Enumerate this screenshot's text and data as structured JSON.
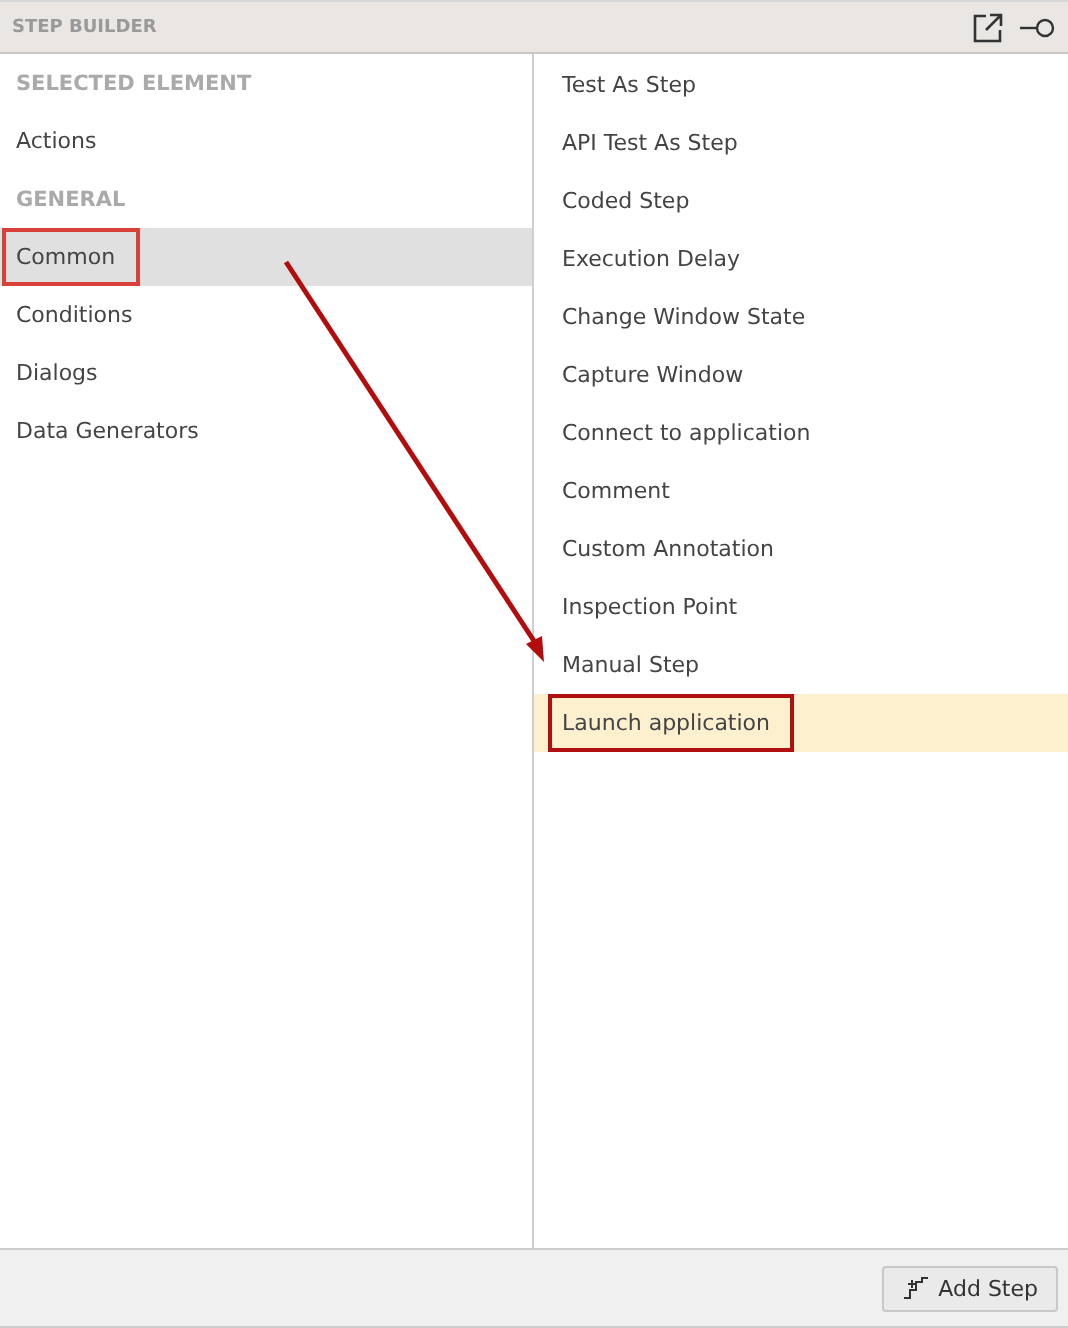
{
  "panel": {
    "title": "STEP BUILDER"
  },
  "categories": [
    {
      "kind": "header",
      "label": "SELECTED ELEMENT",
      "selected": false,
      "outlined": false
    },
    {
      "kind": "item",
      "label": "Actions",
      "selected": false,
      "outlined": false
    },
    {
      "kind": "header",
      "label": "GENERAL",
      "selected": false,
      "outlined": false
    },
    {
      "kind": "item",
      "label": "Common",
      "selected": true,
      "outlined": true
    },
    {
      "kind": "item",
      "label": "Conditions",
      "selected": false,
      "outlined": false
    },
    {
      "kind": "item",
      "label": "Dialogs",
      "selected": false,
      "outlined": false
    },
    {
      "kind": "item",
      "label": "Data Generators",
      "selected": false,
      "outlined": false
    }
  ],
  "steps": [
    {
      "label": "Test As Step",
      "selected": false,
      "outlined": false
    },
    {
      "label": "API Test As Step",
      "selected": false,
      "outlined": false
    },
    {
      "label": "Coded Step",
      "selected": false,
      "outlined": false
    },
    {
      "label": "Execution Delay",
      "selected": false,
      "outlined": false
    },
    {
      "label": "Change Window State",
      "selected": false,
      "outlined": false
    },
    {
      "label": "Capture Window",
      "selected": false,
      "outlined": false
    },
    {
      "label": "Connect to application",
      "selected": false,
      "outlined": false
    },
    {
      "label": "Comment",
      "selected": false,
      "outlined": false
    },
    {
      "label": "Custom Annotation",
      "selected": false,
      "outlined": false
    },
    {
      "label": "Inspection Point",
      "selected": false,
      "outlined": false
    },
    {
      "label": "Manual Step",
      "selected": false,
      "outlined": false
    },
    {
      "label": "Launch application",
      "selected": true,
      "outlined": true
    }
  ],
  "add_button": {
    "label": "Add Step"
  }
}
